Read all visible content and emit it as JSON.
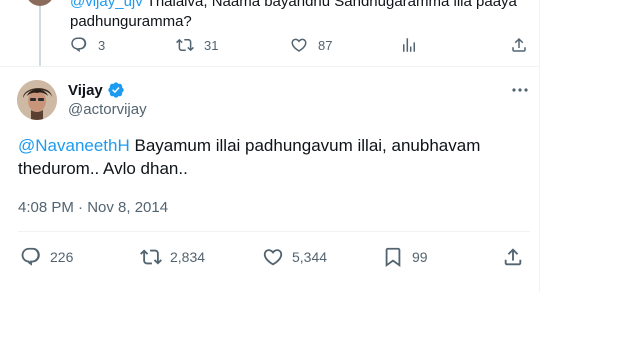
{
  "parent_tweet": {
    "mention": "@vijay_ujv",
    "text_line1": " Thalaiva, Naama bayandhu Sandhugaramma illa paaya",
    "text_line2": "padhunguramma?",
    "actions": {
      "reply_count": "3",
      "retweet_count": "31",
      "like_count": "87"
    }
  },
  "tweet": {
    "author_name": "Vijay",
    "author_handle": "@actorvijay",
    "mention": "@NavaneethH",
    "text": " Bayamum illai padhungavum illai, anubhavam thedurom.. Avlo dhan..",
    "timestamp": "4:08 PM · Nov 8, 2014",
    "actions": {
      "reply_count": "226",
      "retweet_count": "2,834",
      "like_count": "5,344",
      "bookmark_count": "99"
    }
  },
  "colors": {
    "link": "#1d9bf0",
    "secondary_text": "#536471",
    "verified": "#1d9bf0"
  },
  "icons": [
    "reply-icon",
    "retweet-icon",
    "like-icon",
    "analytics-icon",
    "bookmark-icon",
    "share-icon",
    "verified-badge-icon",
    "more-options-icon"
  ]
}
